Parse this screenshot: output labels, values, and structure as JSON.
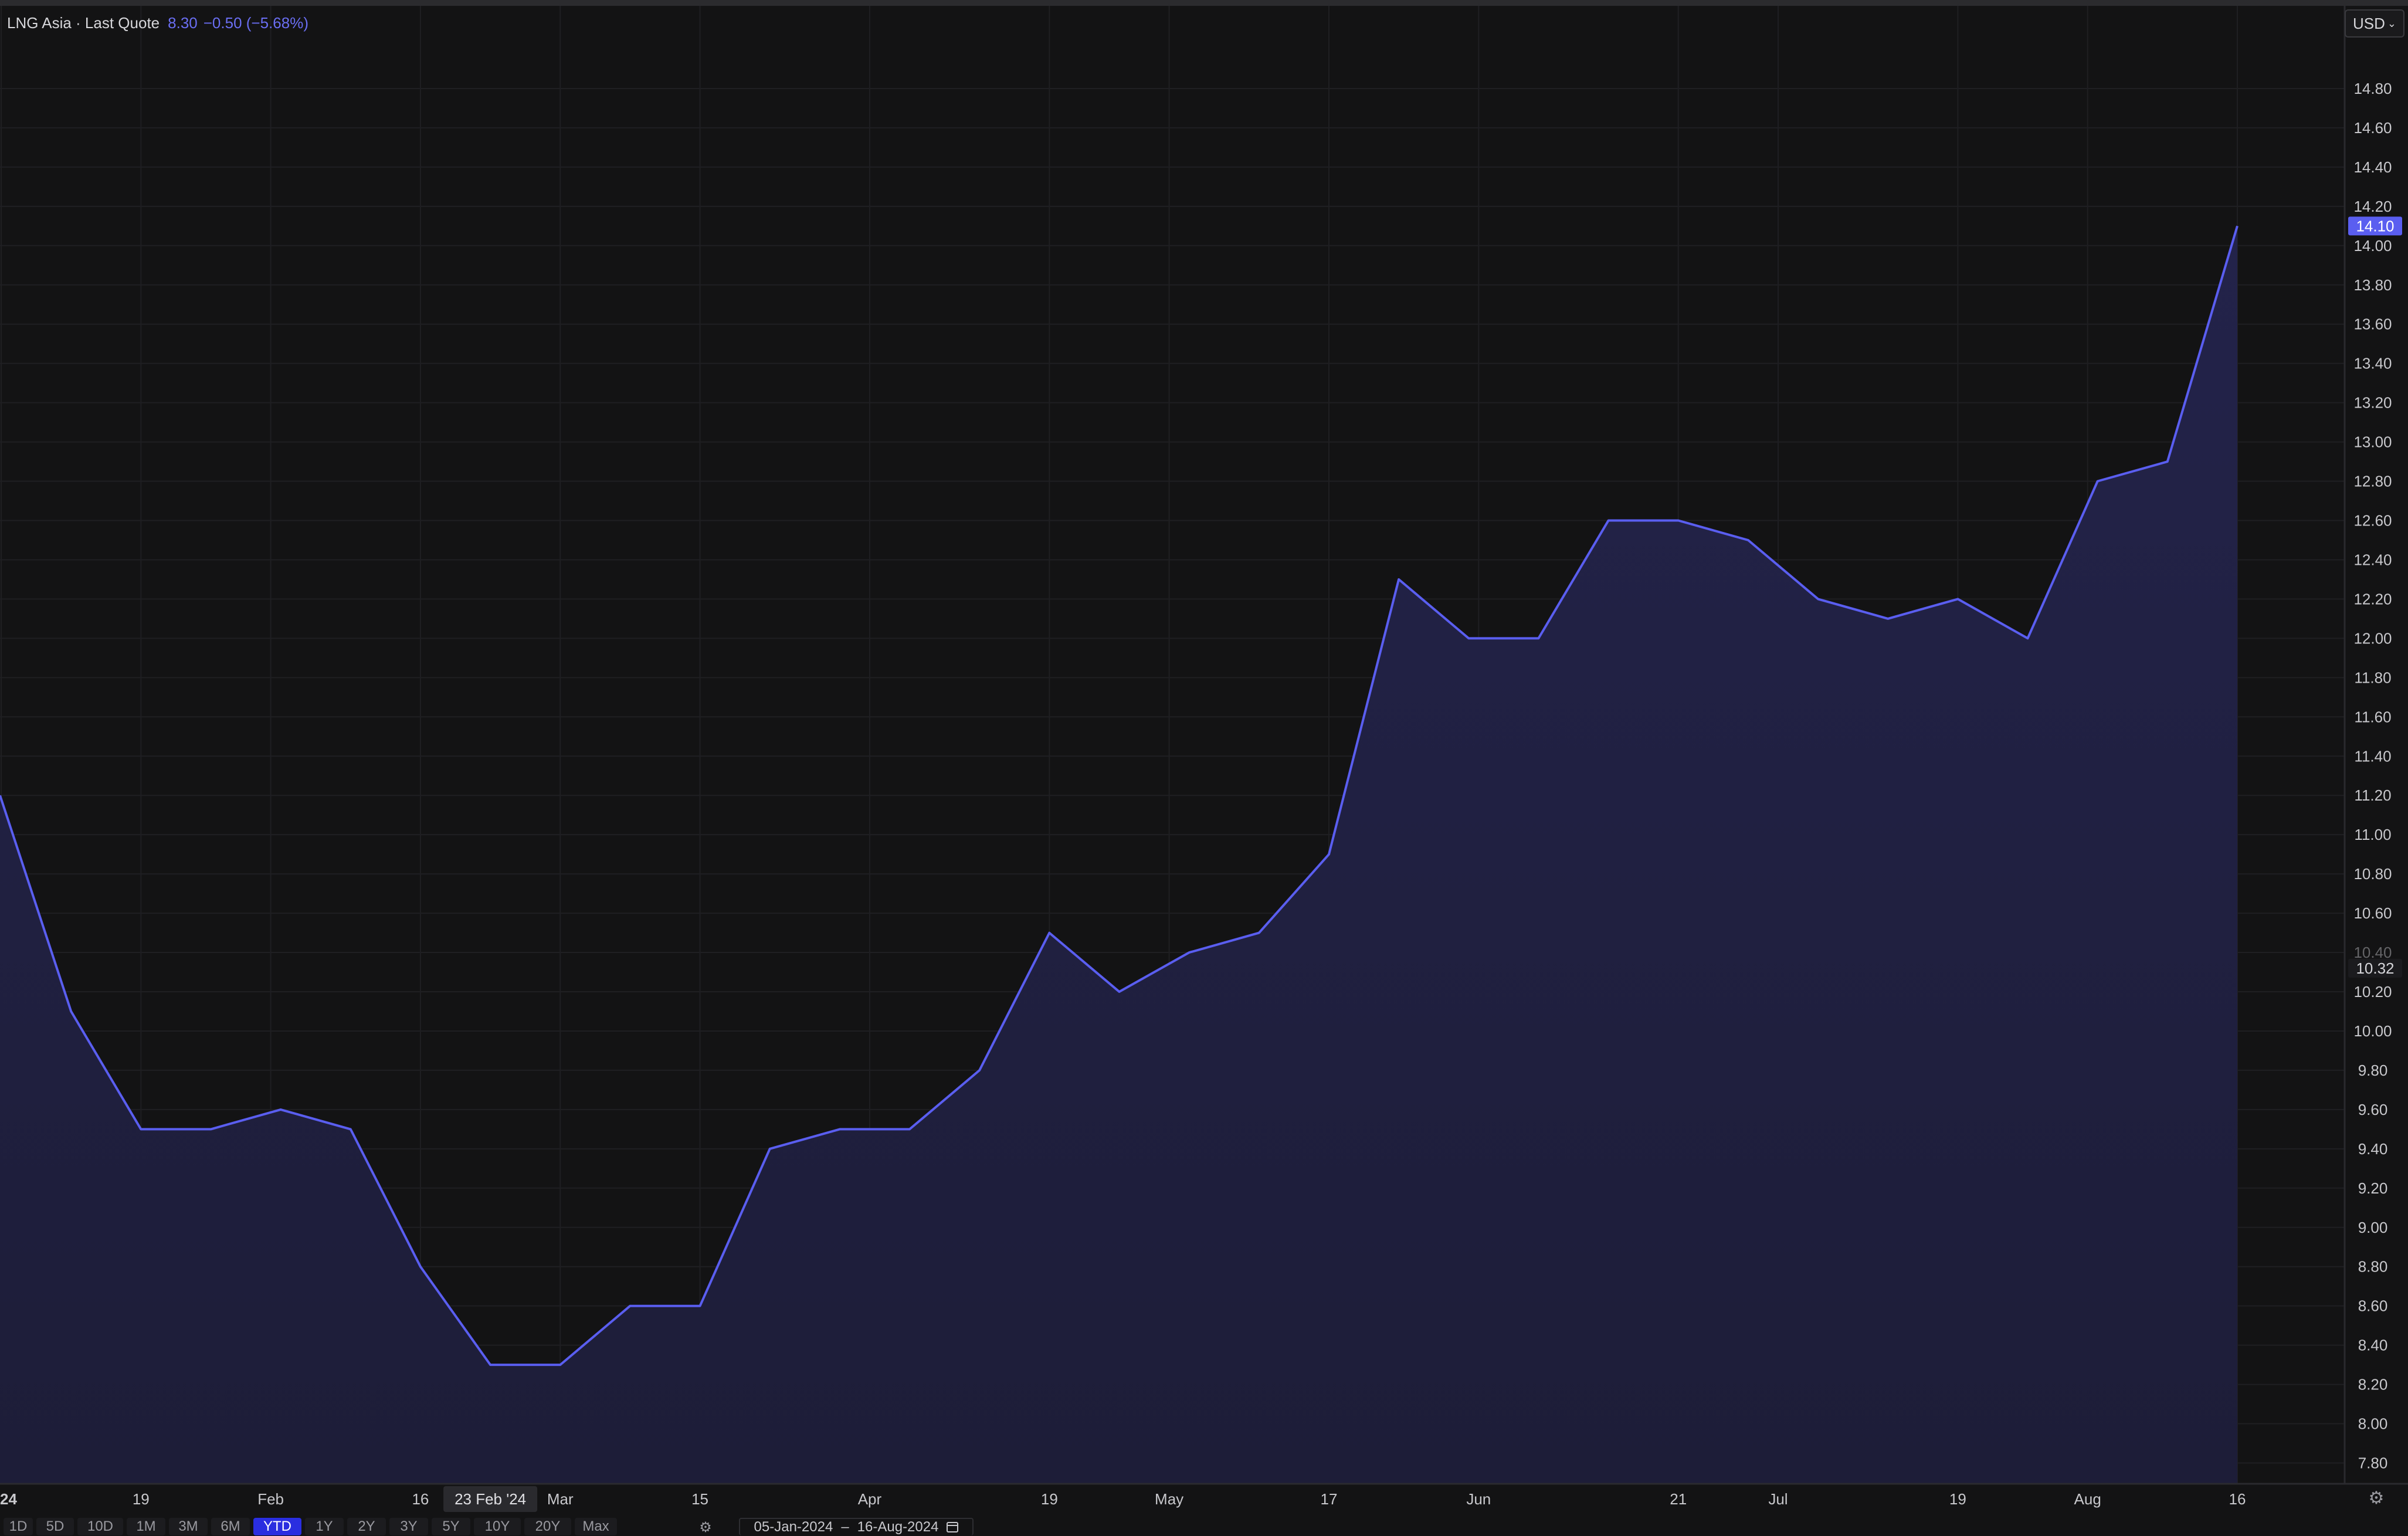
{
  "legend": {
    "name": "LNG Asia · Last Quote",
    "quote": "8.30",
    "change": "−0.50 (−5.68%)"
  },
  "currency": {
    "label": "USD",
    "icon": "chevron-down-icon"
  },
  "colors": {
    "background": "#131314",
    "line": "#5a5ef0",
    "area": "#1d1d38",
    "last_value_badge": "#5a5ef0",
    "active_range": "#2a2ee0"
  },
  "chart_data": {
    "type": "area",
    "title": "LNG Asia",
    "x": [
      "2024-01-05",
      "2024-01-12",
      "2024-01-19",
      "2024-01-26",
      "2024-02-02",
      "2024-02-09",
      "2024-02-16",
      "2024-02-23",
      "2024-03-01",
      "2024-03-08",
      "2024-03-15",
      "2024-03-22",
      "2024-03-29",
      "2024-04-05",
      "2024-04-12",
      "2024-04-19",
      "2024-04-26",
      "2024-05-03",
      "2024-05-10",
      "2024-05-17",
      "2024-05-24",
      "2024-05-31",
      "2024-06-07",
      "2024-06-14",
      "2024-06-21",
      "2024-06-28",
      "2024-07-05",
      "2024-07-12",
      "2024-07-19",
      "2024-07-26",
      "2024-08-02",
      "2024-08-09",
      "2024-08-16"
    ],
    "series": [
      {
        "values": [
          11.2,
          10.1,
          9.5,
          9.5,
          9.6,
          9.5,
          8.8,
          8.3,
          8.3,
          8.6,
          8.6,
          9.4,
          9.5,
          9.5,
          9.8,
          10.5,
          10.2,
          10.4,
          10.5,
          10.9,
          12.3,
          12.0,
          12.0,
          12.6,
          12.6,
          12.5,
          12.2,
          12.1,
          12.2,
          12.0,
          12.8,
          12.9,
          14.1
        ]
      }
    ],
    "ylim": [
      7.7,
      15.0
    ],
    "y_ticks": [
      "7.80",
      "8.00",
      "8.20",
      "8.40",
      "8.60",
      "8.80",
      "9.00",
      "9.20",
      "9.40",
      "9.60",
      "9.80",
      "10.00",
      "10.20",
      "10.40",
      "10.60",
      "10.80",
      "11.00",
      "11.20",
      "11.40",
      "11.60",
      "11.80",
      "12.00",
      "12.20",
      "12.40",
      "12.60",
      "12.80",
      "13.00",
      "13.20",
      "13.40",
      "13.60",
      "13.80",
      "14.00",
      "14.20",
      "14.40",
      "14.60",
      "14.80"
    ],
    "y_ticks_hidden": [
      "10.40"
    ],
    "x_ticks": [
      {
        "date": "2024-01-05",
        "label": "24"
      },
      {
        "date": "2024-01-19",
        "label": "19"
      },
      {
        "date": "2024-02-01",
        "label": "Feb"
      },
      {
        "date": "2024-02-16",
        "label": "16"
      },
      {
        "date": "2024-03-01",
        "label": "Mar"
      },
      {
        "date": "2024-03-15",
        "label": "15"
      },
      {
        "date": "2024-04-01",
        "label": "Apr"
      },
      {
        "date": "2024-04-19",
        "label": "19"
      },
      {
        "date": "2024-05-01",
        "label": "May"
      },
      {
        "date": "2024-05-17",
        "label": "17"
      },
      {
        "date": "2024-06-01",
        "label": "Jun"
      },
      {
        "date": "2024-06-21",
        "label": "21"
      },
      {
        "date": "2024-07-01",
        "label": "Jul"
      },
      {
        "date": "2024-07-19",
        "label": "19"
      },
      {
        "date": "2024-08-01",
        "label": "Aug"
      },
      {
        "date": "2024-08-16",
        "label": "16"
      }
    ],
    "crosshair_label": {
      "date": "2024-02-23",
      "label": "23 Feb '24"
    },
    "price_labels": [
      {
        "value": 14.1,
        "label": "14.10",
        "style": "last"
      },
      {
        "value": 10.32,
        "label": "10.32",
        "style": "marker"
      }
    ],
    "grid": true
  },
  "range_buttons": [
    "1D",
    "5D",
    "10D",
    "1M",
    "3M",
    "6M",
    "YTD",
    "1Y",
    "2Y",
    "3Y",
    "5Y",
    "10Y",
    "20Y",
    "Max"
  ],
  "active_range": "YTD",
  "date_range": {
    "start": "05-Jan-2024",
    "separator": "–",
    "end": "16-Aug-2024"
  }
}
